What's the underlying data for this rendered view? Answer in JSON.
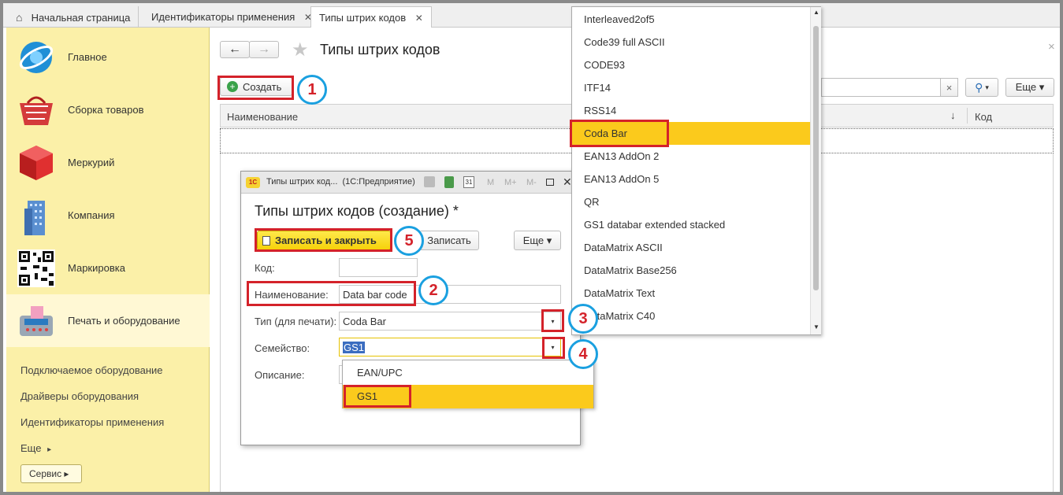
{
  "tabs": [
    {
      "label": "Начальная страница"
    },
    {
      "label": "Идентификаторы применения",
      "close": "✕"
    },
    {
      "label": "Типы штрих кодов",
      "close": "✕"
    }
  ],
  "sidebar": {
    "sections": [
      {
        "label": "Главное",
        "icon": "globe-icon"
      },
      {
        "label": "Сборка товаров",
        "icon": "basket-icon"
      },
      {
        "label": "Меркурий",
        "icon": "cube-icon"
      },
      {
        "label": "Компания",
        "icon": "building-icon"
      },
      {
        "label": "Маркировка",
        "icon": "qr-code-icon"
      },
      {
        "label": "Печать и оборудование",
        "icon": "card-terminal-icon"
      }
    ],
    "links": [
      "Подключаемое оборудование",
      "Драйверы оборудования",
      "Идентификаторы применения",
      "Еще"
    ],
    "more_arrow": "▸",
    "service_button": "Сервис ▸"
  },
  "main": {
    "title": "Типы штрих кодов",
    "create_button": "Создать",
    "search_clear": "×",
    "more_button": "Еще ▾",
    "columns": [
      "Наименование",
      "Код"
    ],
    "sort_arrow": "↓",
    "close": "×"
  },
  "type_list": {
    "items": [
      "Interleaved2of5",
      "Code39 full ASCII",
      "CODE93",
      "ITF14",
      "RSS14",
      "Coda Bar",
      "EAN13 AddOn 2",
      "EAN13 AddOn 5",
      "QR",
      "GS1 databar extended stacked",
      "DataMatrix ASCII",
      "DataMatrix Base256",
      "DataMatrix Text",
      "DataMatrix C40"
    ],
    "selected": "Coda Bar"
  },
  "dialog": {
    "window_title": "Типы штрих код...  (1С:Предприятие)",
    "title": "Типы штрих кодов (создание) *",
    "save_close": "Записать и закрыть",
    "save": "Записать",
    "more": "Еще ▾",
    "toolbar_labels": [
      "M",
      "M+",
      "M-"
    ],
    "fields": {
      "code_label": "Код:",
      "code_value": "",
      "name_label": "Наименование:",
      "name_value": "Data bar code",
      "type_label": "Тип (для печати):",
      "type_value": "Coda Bar",
      "family_label": "Семейство:",
      "family_value": "GS1",
      "desc_label": "Описание:"
    },
    "family_options": [
      "EAN/UPC",
      "GS1"
    ]
  },
  "callouts": [
    "1",
    "2",
    "3",
    "4",
    "5"
  ],
  "colors": {
    "accent_red": "#d4222a",
    "callout_blue": "#1aa0e0",
    "highlight": "#fbca1c",
    "sidebar": "#fbf0a8"
  }
}
